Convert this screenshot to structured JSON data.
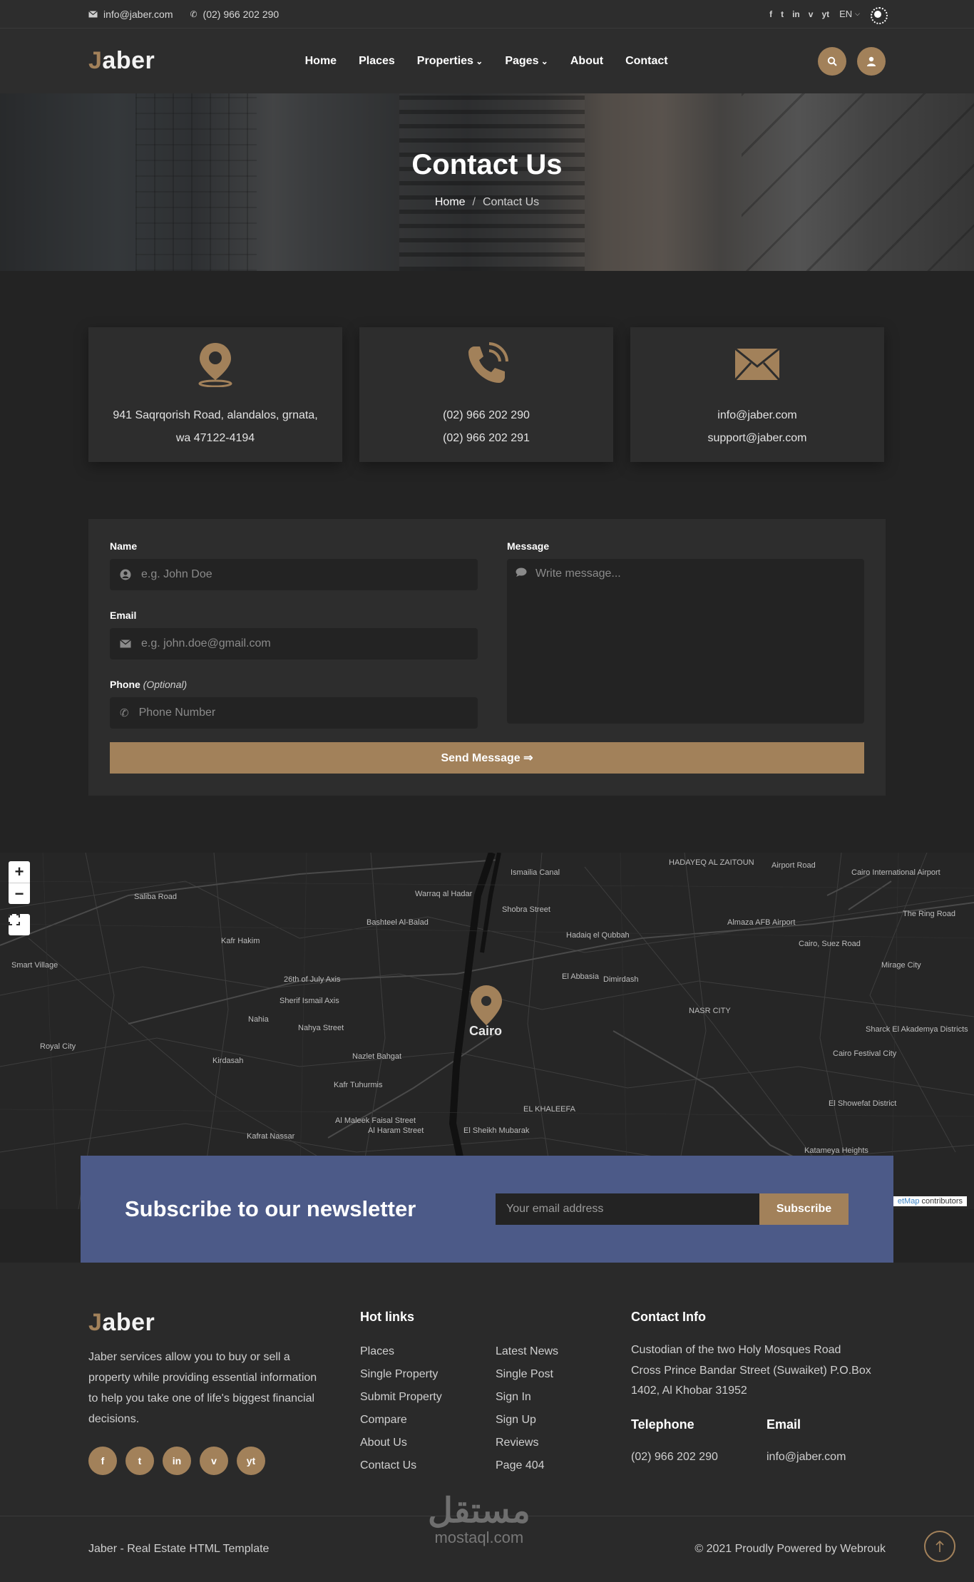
{
  "topbar": {
    "email": "info@jaber.com",
    "phone": "(02) 966 202 290",
    "socials": [
      "f",
      "t",
      "in",
      "v",
      "yt"
    ],
    "lang": "EN"
  },
  "header": {
    "logo_first": "J",
    "logo_rest": "aber",
    "nav": [
      {
        "label": "Home"
      },
      {
        "label": "Places"
      },
      {
        "label": "Properties"
      },
      {
        "label": "Pages"
      },
      {
        "label": "About"
      },
      {
        "label": "Contact"
      }
    ]
  },
  "hero": {
    "title": "Contact Us",
    "breadcrumb_home": "Home",
    "breadcrumb_sep": "/",
    "breadcrumb_current": "Contact Us"
  },
  "cards": [
    {
      "icon": "location-pin-icon",
      "line1": "941 Saqrqorish Road, alandalos, grnata,",
      "line2": "wa 47122-4194"
    },
    {
      "icon": "phone-ringing-icon",
      "line1": "(02) 966 202 290",
      "line2": "(02) 966 202 291"
    },
    {
      "icon": "envelope-icon",
      "line1": "info@jaber.com",
      "line2": "support@jaber.com"
    }
  ],
  "form": {
    "name_label": "Name",
    "name_placeholder": "e.g. John Doe",
    "email_label": "Email",
    "email_placeholder": "e.g. john.doe@gmail.com",
    "phone_label": "Phone",
    "phone_optional": "(Optional)",
    "phone_placeholder": "Phone Number",
    "message_label": "Message",
    "message_placeholder": "Write message...",
    "send_label": "Send Message ⇒"
  },
  "map": {
    "zoom_in": "+",
    "zoom_out": "−",
    "city_label": "Cairo",
    "labels": [
      "Saliba Road",
      "Kafr Hakim",
      "Smart Village",
      "26th of July Axis",
      "Sherif Ismail Axis",
      "Nahia",
      "Nahya Street",
      "Royal City",
      "Kirdasah",
      "Nazlet Bahgat",
      "Kafr Tuhurmis",
      "Kafrat Nassar",
      "Warraq al Hadar",
      "Bashteel Al-Balad",
      "Hadaiq el Qubbah",
      "El Abbasia",
      "Dimirdash",
      "Almaza AFB Airport",
      "Cairo International Airport",
      "HADAYEQ AL ZAITOUN",
      "Cairo, Suez Road",
      "Mirage City",
      "NASR CITY",
      "Sharck El Akademya Districts",
      "Cairo Festival City",
      "El Showefat District",
      "Katameya Heights",
      "EL KHALEEFA",
      "El Sheikh Mubarak",
      "Al Maleek Faisal Street",
      "Al Haram Street",
      "Airport Road",
      "The Ring Road",
      "Ismailia Canal",
      "Shobra Street"
    ],
    "attribution_link": "etMap",
    "attribution_rest": "contributors"
  },
  "newsletter": {
    "title": "Subscribe to our newsletter",
    "placeholder": "Your email address",
    "button": "Subscribe"
  },
  "footer": {
    "about": "Jaber services allow you to buy or sell a property while providing essential information to help you take one of life's biggest financial decisions.",
    "socials": [
      "f",
      "t",
      "in",
      "v",
      "yt"
    ],
    "hot_links_title": "Hot links",
    "links_col1": [
      "Places",
      "Single Property",
      "Submit Property",
      "Compare",
      "About Us",
      "Contact Us"
    ],
    "links_col2": [
      "Latest News",
      "Single Post",
      "Sign In",
      "Sign Up",
      "Reviews",
      "Page 404"
    ],
    "contact_title": "Contact Info",
    "address_lines": [
      "Custodian of the two Holy Mosques Road",
      "Cross Prince Bandar Street (Suwaiket) P.O.Box",
      "1402, Al Khobar 31952"
    ],
    "telephone_title": "Telephone",
    "telephone": "(02) 966 202 290",
    "email_title": "Email",
    "email": "info@jaber.com"
  },
  "bottom": {
    "left": "Jaber - Real Estate HTML Template",
    "right": "© 2021 Proudly Powered by Webrouk",
    "watermark_ar": "مستقل",
    "watermark_lat": "mostaql.com"
  },
  "colors": {
    "accent": "#a2815a",
    "newsletter_bg": "#4c5a88",
    "bg": "#232323"
  }
}
